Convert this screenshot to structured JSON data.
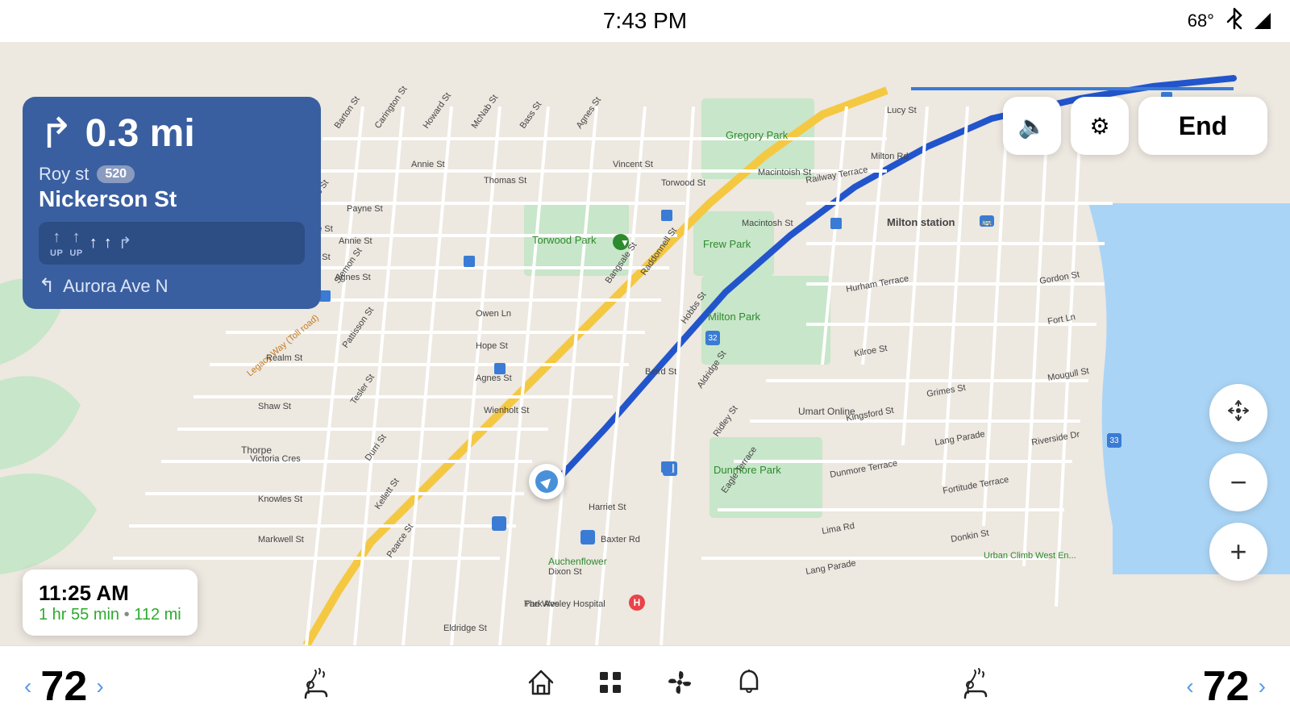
{
  "statusBar": {
    "time": "7:43 PM",
    "temperature": "68°",
    "bluetoothIcon": "⚡",
    "signalIcon": "▲"
  },
  "navigation": {
    "distance": "0.3 mi",
    "turnArrow": "↱",
    "streetLine1": "Roy st",
    "routeBadge": "520",
    "streetLine2": "Nickerson St",
    "lanes": [
      {
        "label": "UP",
        "arrow": "↑",
        "active": false
      },
      {
        "label": "UP",
        "arrow": "↑",
        "active": false
      },
      {
        "label": "",
        "arrow": "↑",
        "active": true
      },
      {
        "label": "",
        "arrow": "↑",
        "active": true
      },
      {
        "label": "",
        "arrow": "↱",
        "active": false
      }
    ],
    "nextTurn": "Aurora Ave N",
    "nextTurnArrow": "↰"
  },
  "eta": {
    "arrivalTime": "11:25 AM",
    "duration": "1 hr 55 min",
    "distance": "112 mi",
    "separator": "•"
  },
  "controls": {
    "muteLabel": "🔈",
    "settingsLabel": "⚙",
    "endLabel": "End"
  },
  "mapControls": {
    "moveLabel": "⤢",
    "zoomOutLabel": "−",
    "zoomInLabel": "+"
  },
  "bottomBar": {
    "leftTemp": "72",
    "leftHeatIcon": "seat-heat",
    "homeIcon": "home",
    "gridIcon": "grid",
    "fanIcon": "fan",
    "bellIcon": "bell",
    "rightHeatIcon": "seat-heat-right",
    "rightTemp": "72",
    "leftArrowLeft": "‹",
    "leftArrowRight": "›",
    "rightArrowLeft": "‹",
    "rightArrowRight": "›"
  },
  "mapLabels": {
    "gregoryPark": "Gregory Park",
    "frewPark": "Frew Park",
    "torwoodPark": "Torwood Park",
    "miltonPark": "Milton Park",
    "dunmorePark": "Dunmore Park",
    "miltonStation": "Milton station",
    "umartOnline": "Umart Online",
    "auchenflower": "Auchenflower",
    "wesleyHospital": "The Wesley Hospital",
    "urbanClimb": "Urban Climb West En...",
    "legacyWay": "Legacy Way (Toll road)",
    "thorpe": "Thorpe"
  }
}
